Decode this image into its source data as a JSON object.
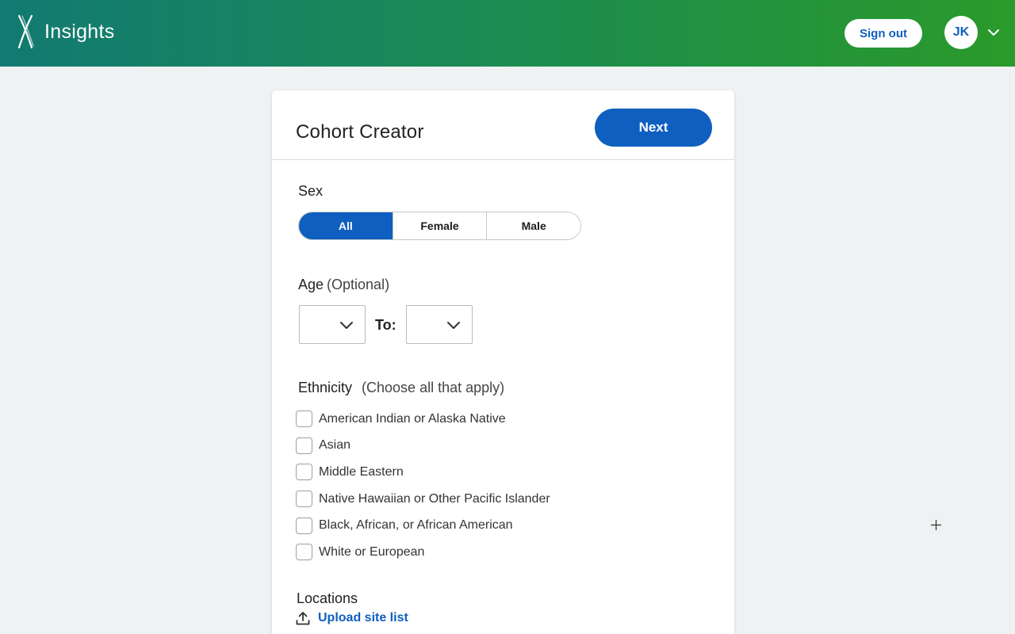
{
  "header": {
    "brand_name": "Insights",
    "signout_label": "Sign out",
    "avatar_initials": "JK",
    "icons": {
      "logo": "x-helix-logo",
      "menu": "chevron-down-icon"
    }
  },
  "card": {
    "title": "Cohort Creator",
    "next_label": "Next",
    "sex": {
      "label": "Sex",
      "options": [
        "All",
        "Female",
        "Male"
      ],
      "selected": "All"
    },
    "age": {
      "label": "Age",
      "optional": "(Optional)",
      "to_label": "To:",
      "from_value": "",
      "to_value": ""
    },
    "ethnicity": {
      "label": "Ethnicity",
      "hint": "(Choose all that apply)",
      "options": [
        "American Indian or Alaska Native",
        "Asian",
        "Middle Eastern",
        "Native Hawaiian or Other Pacific Islander",
        "Black, African, or African American",
        "White or European"
      ]
    },
    "locations": {
      "label": "Locations",
      "upload_label": "Upload site list"
    }
  },
  "colors": {
    "primary": "#0e5fbf",
    "header_gradient_start": "#127a72",
    "header_gradient_end": "#2a9a2a",
    "page_bg": "#eef2f2"
  }
}
